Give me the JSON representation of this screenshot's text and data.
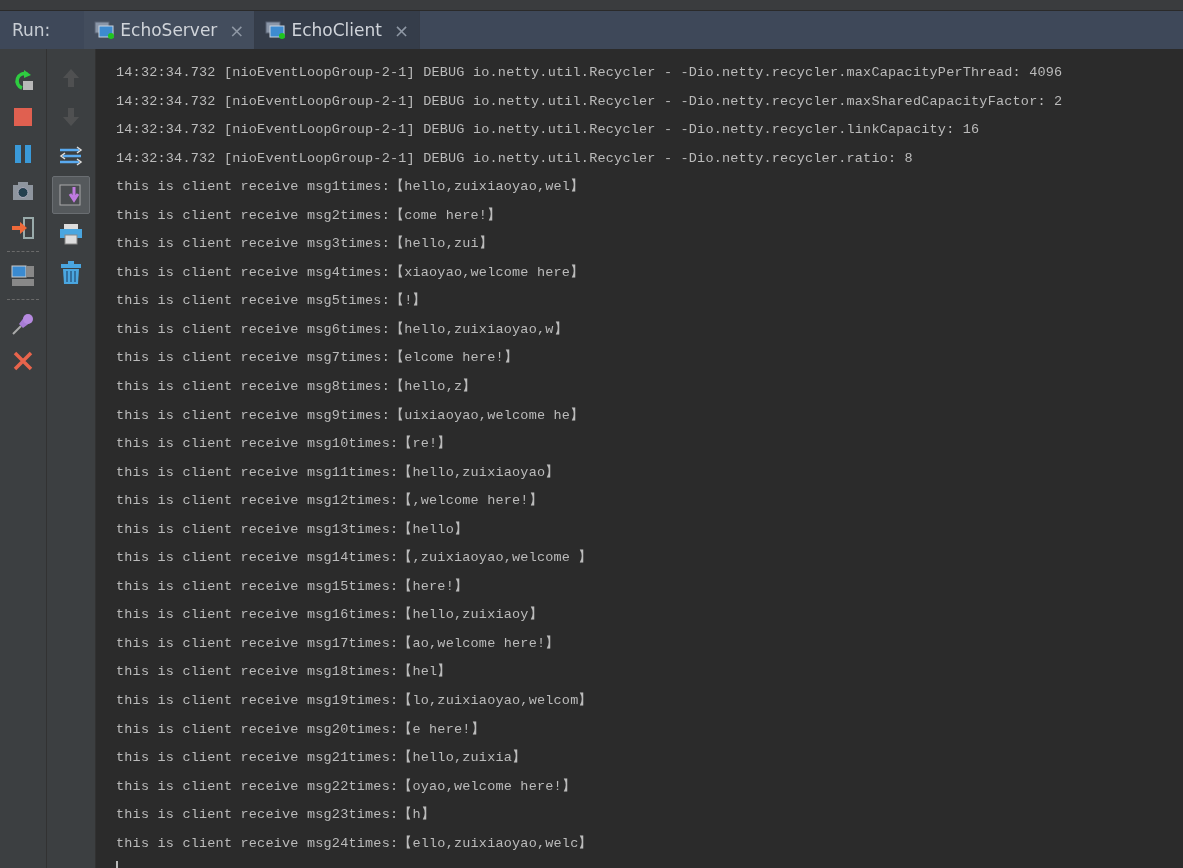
{
  "run_panel": {
    "label": "Run:",
    "tabs": [
      {
        "label": "EchoServer",
        "selected": false,
        "close": "×"
      },
      {
        "label": "EchoClient",
        "selected": true,
        "close": "×"
      }
    ]
  },
  "toolbar_main": [
    {
      "kind": "rerun"
    },
    {
      "kind": "stop"
    },
    {
      "kind": "pause"
    },
    {
      "kind": "camera"
    },
    {
      "kind": "exit"
    },
    {
      "kind": "separator"
    },
    {
      "kind": "layout"
    },
    {
      "kind": "separator"
    },
    {
      "kind": "pin"
    },
    {
      "kind": "close"
    }
  ],
  "toolbar_side": [
    {
      "kind": "up",
      "disabled": true,
      "on": false
    },
    {
      "kind": "down",
      "disabled": true,
      "on": false
    },
    {
      "kind": "wrap",
      "disabled": false,
      "on": false
    },
    {
      "kind": "scroll-end",
      "disabled": false,
      "on": true
    },
    {
      "kind": "print",
      "disabled": false,
      "on": false
    },
    {
      "kind": "trash",
      "disabled": false,
      "on": false
    }
  ],
  "console_lines": [
    "14:32:34.732 [nioEventLoopGroup-2-1] DEBUG io.netty.util.Recycler - -Dio.netty.recycler.maxCapacityPerThread: 4096",
    "14:32:34.732 [nioEventLoopGroup-2-1] DEBUG io.netty.util.Recycler - -Dio.netty.recycler.maxSharedCapacityFactor: 2",
    "14:32:34.732 [nioEventLoopGroup-2-1] DEBUG io.netty.util.Recycler - -Dio.netty.recycler.linkCapacity: 16",
    "14:32:34.732 [nioEventLoopGroup-2-1] DEBUG io.netty.util.Recycler - -Dio.netty.recycler.ratio: 8",
    "this is client receive msg1times:【hello,zuixiaoyao,wel】",
    "this is client receive msg2times:【come here!】",
    "this is client receive msg3times:【hello,zui】",
    "this is client receive msg4times:【xiaoyao,welcome here】",
    "this is client receive msg5times:【!】",
    "this is client receive msg6times:【hello,zuixiaoyao,w】",
    "this is client receive msg7times:【elcome here!】",
    "this is client receive msg8times:【hello,z】",
    "this is client receive msg9times:【uixiaoyao,welcome he】",
    "this is client receive msg10times:【re!】",
    "this is client receive msg11times:【hello,zuixiaoyao】",
    "this is client receive msg12times:【,welcome here!】",
    "this is client receive msg13times:【hello】",
    "this is client receive msg14times:【,zuixiaoyao,welcome 】",
    "this is client receive msg15times:【here!】",
    "this is client receive msg16times:【hello,zuixiaoy】",
    "this is client receive msg17times:【ao,welcome here!】",
    "this is client receive msg18times:【hel】",
    "this is client receive msg19times:【lo,zuixiaoyao,welcom】",
    "this is client receive msg20times:【e here!】",
    "this is client receive msg21times:【hello,zuixia】",
    "this is client receive msg22times:【oyao,welcome here!】",
    "this is client receive msg23times:【h】",
    "this is client receive msg24times:【ello,zuixiaoyao,welc】"
  ]
}
